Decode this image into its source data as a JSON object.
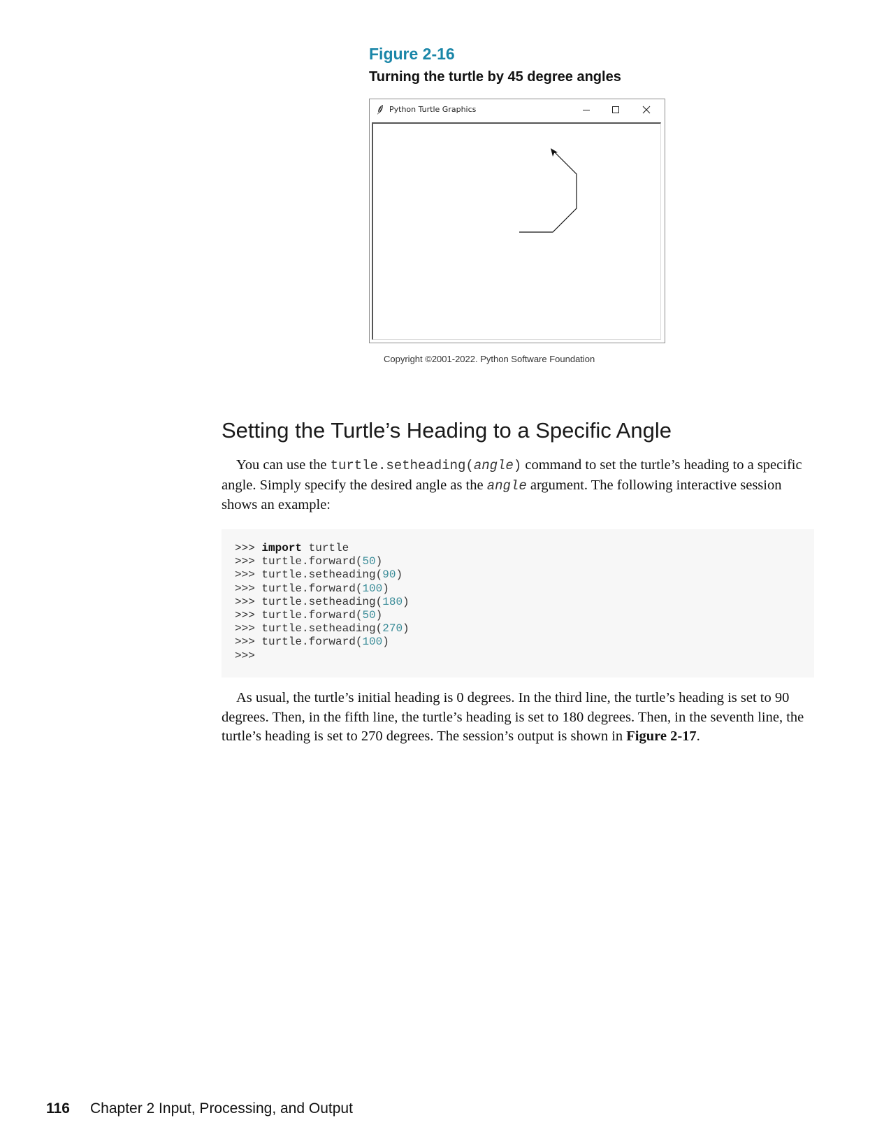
{
  "figure": {
    "label": "Figure 2-16",
    "caption": "Turning the turtle by 45 degree angles",
    "window_title": "Python Turtle Graphics",
    "credit": "Copyright ©2001-2022. Python Software Foundation",
    "icons": [
      "feather-icon",
      "minimize-icon",
      "maximize-icon",
      "close-icon"
    ]
  },
  "section": {
    "heading": "Setting the Turtle’s Heading to a Specific Angle"
  },
  "paragraph1": {
    "t1": "You can use the ",
    "code_fn": "turtle.setheading(",
    "code_arg": "angle",
    "code_close": ")",
    "t2": " command to set the turtle’s heading to a specific angle. Simply specify the desired angle as the ",
    "code_arg2": "angle",
    "t3": " argument. The following interactive session shows an example:"
  },
  "code": {
    "prompt": ">>> ",
    "lines": [
      {
        "kw": "import",
        "text": " turtle"
      },
      {
        "call": "turtle.forward(",
        "num": "50",
        "close": ")"
      },
      {
        "call": "turtle.setheading(",
        "num": "90",
        "close": ")"
      },
      {
        "call": "turtle.forward(",
        "num": "100",
        "close": ")"
      },
      {
        "call": "turtle.setheading(",
        "num": "180",
        "close": ")"
      },
      {
        "call": "turtle.forward(",
        "num": "50",
        "close": ")"
      },
      {
        "call": "turtle.setheading(",
        "num": "270",
        "close": ")"
      },
      {
        "call": "turtle.forward(",
        "num": "100",
        "close": ")"
      },
      {
        "empty": true
      }
    ]
  },
  "paragraph2": {
    "text": "As usual, the turtle’s initial heading is 0 degrees. In the third line, the turtle’s heading is set to 90 degrees. Then, in the fifth line, the turtle’s heading is set to 180 degrees. Then, in the seventh line, the turtle’s heading is set to 270 degrees. The session’s output is shown in ",
    "ref": "Figure 2-17",
    "end": "."
  },
  "footer": {
    "page_number": "116",
    "chapter": "Chapter 2 Input, Processing, and Output"
  }
}
